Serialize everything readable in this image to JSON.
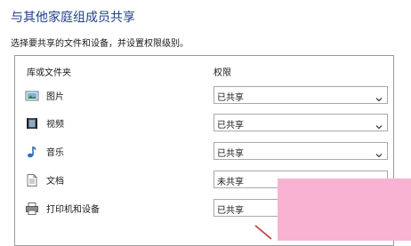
{
  "page": {
    "title": "与其他家庭组成员共享",
    "instructions": "选择要共享的文件和设备，并设置权限级别。"
  },
  "table": {
    "headers": {
      "library": "库或文件夹",
      "permission": "权限"
    },
    "rows": [
      {
        "icon": "pictures-icon",
        "label": "图片",
        "permission": "已共享"
      },
      {
        "icon": "videos-icon",
        "label": "视频",
        "permission": "已共享"
      },
      {
        "icon": "music-icon",
        "label": "音乐",
        "permission": "已共享"
      },
      {
        "icon": "documents-icon",
        "label": "文档",
        "permission": "未共享"
      },
      {
        "icon": "printer-icon",
        "label": "打印机和设备",
        "permission": "已共享"
      }
    ]
  },
  "colors": {
    "title": "#1e3f8c",
    "overlay": "#f8b3d3",
    "annotation_arrow": "#c0504d"
  }
}
